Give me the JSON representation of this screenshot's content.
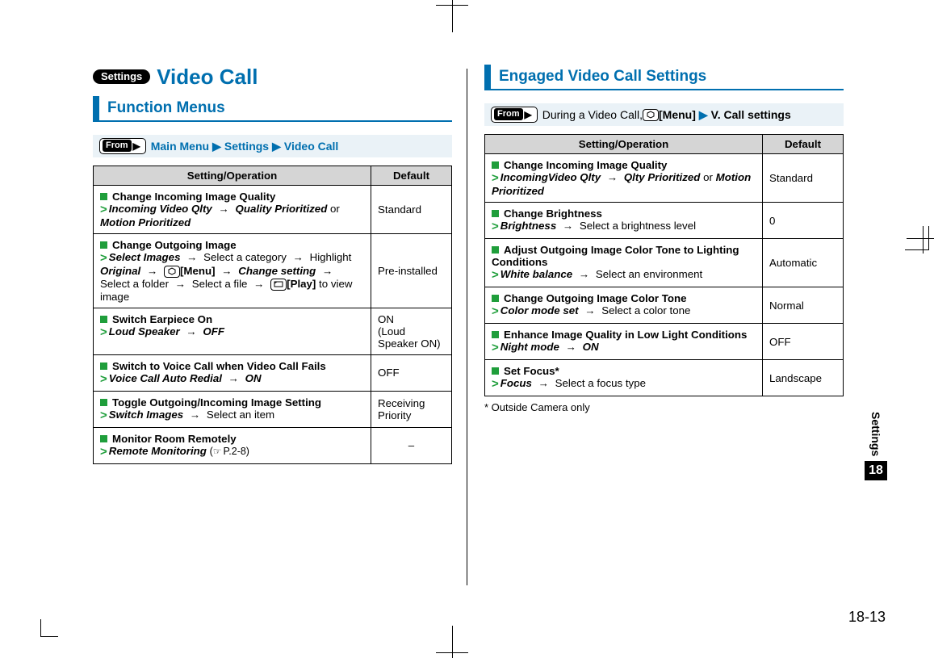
{
  "badge": "Settings",
  "h1": "Video Call",
  "left": {
    "section_title": "Function Menus",
    "from": {
      "label": "From",
      "path": [
        "Main Menu",
        "Settings",
        "Video Call"
      ]
    },
    "table": {
      "col_op": "Setting/Operation",
      "col_def": "Default",
      "rows": [
        {
          "title": "Change Incoming Image Quality",
          "steps_html": "<span class='chev'>&gt;</span><span class='step'>Incoming Video Qlty</span> <span class='arrow'>→</span> <span class='step'>Quality Prioritized</span> or <span class='step'>Motion Prioritized</span>",
          "default": "Standard"
        },
        {
          "title": "Change Outgoing Image",
          "steps_html": "<span class='chev'>&gt;</span><span class='step'>Select Images</span> <span class='arrow'>→</span> Select a category <span class='arrow'>→</span> Highlight <span class='step'>Original</span> <span class='arrow'>→</span> <span class='key'><svg viewBox='0 0 12 10'><path d='M2 3 L6 1 L10 3 L10 7 L6 9 L2 7 Z' fill='none' stroke='#000' stroke-width='1'/></svg></span><b>[Menu]</b> <span class='arrow'>→</span> <span class='step'>Change setting</span> <span class='arrow'>→</span> Select a folder <span class='arrow'>→</span> Select a file <span class='arrow'>→</span> <span class='key'><svg viewBox='0 0 12 10'><rect x='1' y='2' width='10' height='6' fill='none' stroke='#000' stroke-width='1'/><path d='M1 4 L4 2' stroke='#000' stroke-width='1' fill='none'/></svg></span><b>[Play]</b> to view image",
          "default": "Pre-installed"
        },
        {
          "title": "Switch Earpiece On",
          "steps_html": "<span class='chev'>&gt;</span><span class='step'>Loud Speaker</span> <span class='arrow'>→</span> <span class='step'>OFF</span>",
          "default": "ON<br>(Loud Speaker ON)"
        },
        {
          "title": "Switch to Voice Call when Video Call Fails",
          "steps_html": "<span class='chev'>&gt;</span><span class='step'>Voice Call Auto Redial</span> <span class='arrow'>→</span> <span class='step'>ON</span>",
          "default": "OFF"
        },
        {
          "title": "Toggle Outgoing/Incoming Image Setting",
          "steps_html": "<span class='chev'>&gt;</span><span class='step'>Switch Images</span> <span class='arrow'>→</span> Select an item",
          "default": "Receiving Priority"
        },
        {
          "title": "Monitor Room Remotely",
          "steps_html": "<span class='chev'>&gt;</span><span class='step'>Remote Monitoring</span> <span class='ref'>(<span class='pointer-icon'>☞</span>P.2-8)</span>",
          "default": "–"
        }
      ]
    }
  },
  "right": {
    "section_title": "Engaged Video Call Settings",
    "from": {
      "label": "From",
      "prefix": "During a Video Call, ",
      "menu_label": "[Menu]",
      "tail": "V. Call settings"
    },
    "table": {
      "col_op": "Setting/Operation",
      "col_def": "Default",
      "rows": [
        {
          "title": "Change Incoming Image Quality",
          "steps_html": "<span class='chev'>&gt;</span><span class='step'>IncomingVideo Qlty</span> <span class='arrow'>→</span> <span class='step'>Qlty Prioritized</span> or <span class='step'>Motion Prioritized</span>",
          "default": "Standard"
        },
        {
          "title": "Change Brightness",
          "steps_html": "<span class='chev'>&gt;</span><span class='step'>Brightness</span> <span class='arrow'>→</span> Select a brightness level",
          "default": "0"
        },
        {
          "title": "Adjust Outgoing Image Color Tone to Lighting Conditions",
          "steps_html": "<span class='chev'>&gt;</span><span class='step'>White balance</span> <span class='arrow'>→</span> Select an environment",
          "default": "Automatic"
        },
        {
          "title": "Change Outgoing Image Color Tone",
          "steps_html": "<span class='chev'>&gt;</span><span class='step'>Color mode set</span> <span class='arrow'>→</span> Select a color tone",
          "default": "Normal"
        },
        {
          "title": "Enhance Image Quality in Low Light Conditions",
          "steps_html": "<span class='chev'>&gt;</span><span class='step'>Night mode</span> <span class='arrow'>→</span> <span class='step'>ON</span>",
          "default": "OFF"
        },
        {
          "title": "Set Focus*",
          "steps_html": "<span class='chev'>&gt;</span><span class='step'>Focus</span> <span class='arrow'>→</span> Select a focus type",
          "default": "Landscape"
        }
      ]
    },
    "footnote": "* Outside Camera only"
  },
  "side_tab": {
    "label": "Settings",
    "chapter": "18"
  },
  "page_number": "18-13"
}
